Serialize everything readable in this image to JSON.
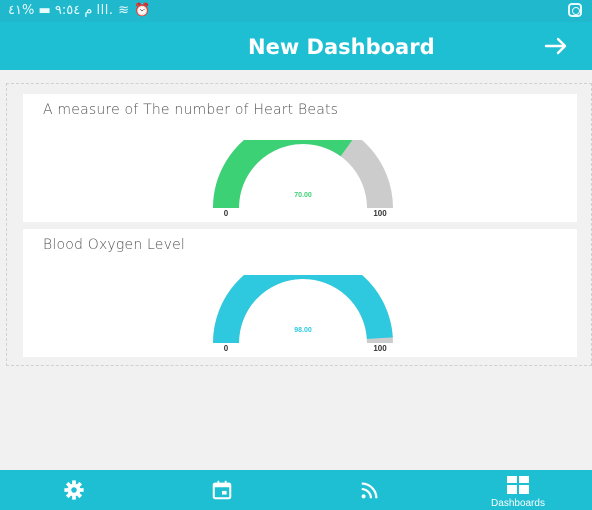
{
  "status_bar": {
    "text": "م ٩:٥٤ ▬ %٤١ lll. ≋ ⏰"
  },
  "app_bar": {
    "title": "New Dashboard",
    "arrow_icon": "arrow-right-icon"
  },
  "colors": {
    "primary": "#1fbfd3",
    "heart_gauge": "#3dd176",
    "oxygen_gauge": "#2ec9de",
    "track": "#cccccc"
  },
  "cards": [
    {
      "title": "A measure of The number of Heart Beats",
      "value": "70.00",
      "min": "0",
      "max": "100",
      "level": 0.7,
      "color": "#3dd176"
    },
    {
      "title": "Blood Oxygen Level",
      "value": "98.00",
      "min": "0",
      "max": "100",
      "level": 0.98,
      "color": "#2ec9de"
    }
  ],
  "bottom_nav": {
    "items": [
      {
        "icon": "gear-icon",
        "label": ""
      },
      {
        "icon": "calendar-icon",
        "label": ""
      },
      {
        "icon": "rss-icon",
        "label": ""
      },
      {
        "icon": "dashboard-icon",
        "label": "Dashboards"
      }
    ]
  }
}
